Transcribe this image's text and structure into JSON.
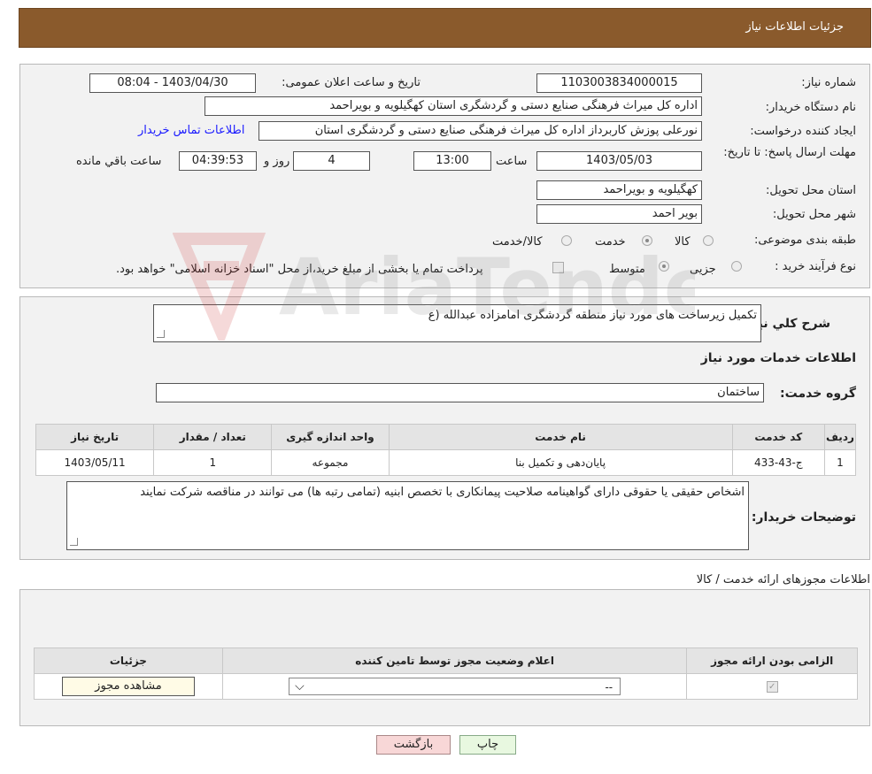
{
  "header": {
    "title": "جزئیات اطلاعات نیاز"
  },
  "form": {
    "need_number_label": "شماره نیاز:",
    "need_number": "1103003834000015",
    "announce_label": "تاریخ و ساعت اعلان عمومی:",
    "announce_value": "1403/04/30 - 08:04",
    "buyer_label": "نام دستگاه خریدار:",
    "buyer_value": "اداره کل میراث فرهنگی  صنایع دستی و گردشگری استان کهگیلویه و بویراحمد",
    "creator_label": "ایجاد کننده درخواست:",
    "creator_value": "نورعلی پوزش کاربرداز اداره کل میراث فرهنگی  صنایع دستی و گردشگری استان",
    "contact_link": "اطلاعات تماس خریدار",
    "deadline_label": "مهلت ارسال پاسخ: تا تاریخ:",
    "deadline_date": "1403/05/03",
    "time_label": "ساعت",
    "deadline_time": "13:00",
    "days_value": "4",
    "days_label": "روز و",
    "remaining_value": "04:39:53",
    "remaining_label": "ساعت باقي مانده",
    "province_label": "استان محل تحویل:",
    "province_value": "کهگیلویه و بویراحمد",
    "city_label": "شهر محل تحویل:",
    "city_value": "بویر احمد",
    "category_label": "طبقه بندی موضوعی:",
    "category_options": [
      "کالا",
      "خدمت",
      "کالا/خدمت"
    ],
    "process_label": "نوع فرآیند خرید :",
    "process_options": [
      "جزیی",
      "متوسط"
    ],
    "payment_note": "پرداخت تمام یا بخشی از مبلغ خرید،از محل \"اسناد خزانه اسلامی\" خواهد بود."
  },
  "summary": {
    "label": "شرح كلي نياز:",
    "value": "تکمیل زیرساخت  های مورد نیاز منطقه گردشگری امامزاده عبدالله (ع",
    "services_title": "اطلاعات خدمات مورد نیاز",
    "group_label": "گروه خدمت:",
    "group_value": "ساختمان",
    "table": {
      "headers": [
        "ردیف",
        "کد خدمت",
        "نام خدمت",
        "واحد اندازه گیری",
        "تعداد / مقدار",
        "تاریخ نیاز"
      ],
      "rows": [
        [
          "1",
          "ج-43-433",
          "پایان‌دهی و تکمیل بنا",
          "مجموعه",
          "1",
          "1403/05/11"
        ]
      ]
    },
    "buyer_notes_label": "توضیحات خریدار:",
    "buyer_notes": "اشخاص حقیقی یا حقوقی دارای گواهینامه صلاحیت پیمانکاری با تخصص ابنیه (تمامی رتبه ها) می توانند در مناقصه شرکت نمایند"
  },
  "permits": {
    "title": "اطلاعات مجوزهای ارائه خدمت / کالا",
    "headers": [
      "الزامی بودن ارائه مجوز",
      "اعلام وضعیت مجوز توسط تامین کننده",
      "جزئیات"
    ],
    "select_value": "--",
    "view_button": "مشاهده مجوز"
  },
  "actions": {
    "print": "چاپ",
    "back": "بازگشت"
  },
  "watermark": {
    "text": "AriaTender.neT"
  },
  "colors": {
    "header_bg": "#8a5a2c",
    "link": "#1a1aff",
    "back_btn": "#f8d7d7",
    "print_btn": "#e8f8e0"
  }
}
